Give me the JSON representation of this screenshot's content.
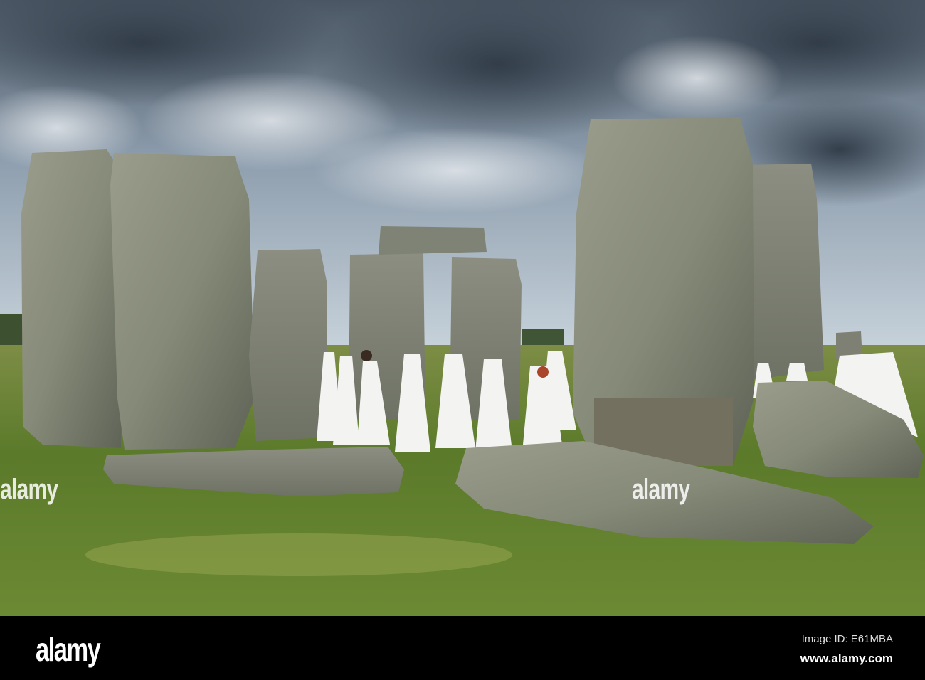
{
  "photo": {
    "subject": "stonehenge-druids",
    "colors": {
      "sky": "#9fb0bf",
      "cloud_dark": "#3a4552",
      "grass": "#5e7a2c",
      "stone": "#8f9282",
      "robe": "#f4f4f2"
    }
  },
  "watermark": {
    "logo": "alamy",
    "image_id": "Image ID: E61MBA",
    "url": "www.alamy.com"
  }
}
